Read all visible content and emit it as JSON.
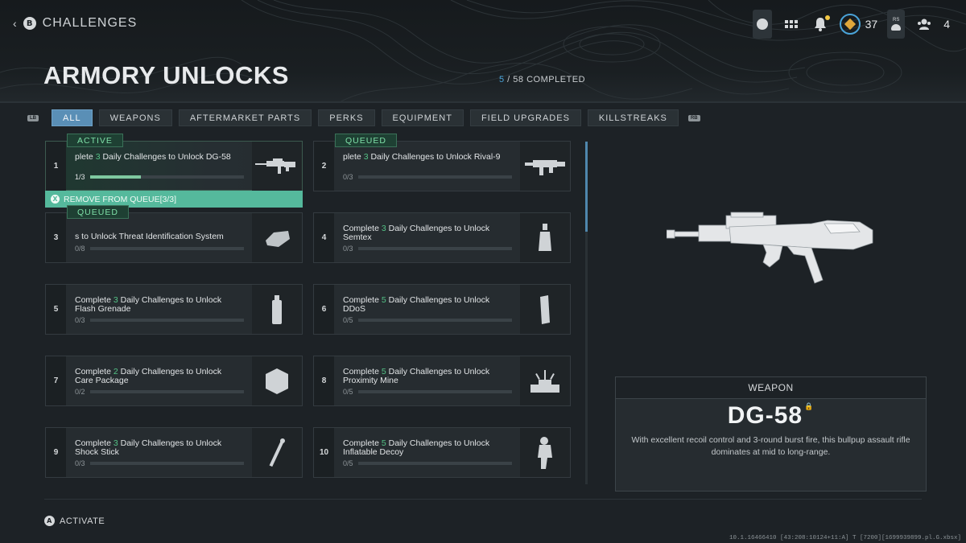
{
  "header": {
    "back_button_glyph": "B",
    "back_label": "CHALLENGES",
    "page_title": "ARMORY UNLOCKS",
    "completed_count": "5",
    "completed_rest": " / 58 COMPLETED"
  },
  "topbar": {
    "rank_level": "37",
    "rs_label": "RS",
    "friends_count": "4"
  },
  "tabs": {
    "left_bumper": "LB",
    "right_bumper": "RB",
    "items": [
      {
        "label": "ALL",
        "active": true
      },
      {
        "label": "WEAPONS"
      },
      {
        "label": "AFTERMARKET PARTS"
      },
      {
        "label": "PERKS"
      },
      {
        "label": "EQUIPMENT"
      },
      {
        "label": "FIELD UPGRADES"
      },
      {
        "label": "KILLSTREAKS"
      }
    ]
  },
  "challenges": [
    {
      "num": "1",
      "badge": "ACTIVE",
      "pre": "plete ",
      "n": "3",
      "post": " Daily Challenges to Unlock DG-58",
      "line2": "",
      "progress_text": "1/3",
      "progress": 0.33,
      "thumb": "rifle-thumb-icon"
    },
    {
      "num": "2",
      "badge": "QUEUED",
      "pre": "plete ",
      "n": "3",
      "post": " Daily Challenges to Unlock Rival-9",
      "line2": "",
      "progress_text": "0/3",
      "progress": 0,
      "thumb": "smg-thumb-icon"
    },
    {
      "num": "3",
      "badge": "QUEUED",
      "pre": "s to Unlock Threat Identification System",
      "n": "",
      "post": "",
      "line2": "",
      "progress_text": "0/8",
      "progress": 0,
      "thumb": "perk-thumb-icon"
    },
    {
      "num": "4",
      "badge": "",
      "pre": "Complete ",
      "n": "3",
      "post": " Daily Challenges to Unlock",
      "line2": "Semtex",
      "progress_text": "0/3",
      "progress": 0,
      "thumb": "semtex-thumb-icon"
    },
    {
      "num": "5",
      "badge": "",
      "pre": "Complete ",
      "n": "3",
      "post": " Daily Challenges to Unlock",
      "line2": "Flash Grenade",
      "progress_text": "0/3",
      "progress": 0,
      "thumb": "flash-grenade-thumb-icon"
    },
    {
      "num": "6",
      "badge": "",
      "pre": "Complete ",
      "n": "5",
      "post": " Daily Challenges to Unlock",
      "line2": "DDoS",
      "progress_text": "0/5",
      "progress": 0,
      "thumb": "ddos-thumb-icon"
    },
    {
      "num": "7",
      "badge": "",
      "pre": "Complete ",
      "n": "2",
      "post": " Daily Challenges to Unlock",
      "line2": "Care Package",
      "progress_text": "0/2",
      "progress": 0,
      "thumb": "care-package-thumb-icon"
    },
    {
      "num": "8",
      "badge": "",
      "pre": "Complete ",
      "n": "5",
      "post": " Daily Challenges to Unlock",
      "line2": "Proximity Mine",
      "progress_text": "0/5",
      "progress": 0,
      "thumb": "proximity-mine-thumb-icon"
    },
    {
      "num": "9",
      "badge": "",
      "pre": "Complete ",
      "n": "3",
      "post": " Daily Challenges to Unlock",
      "line2": "Shock Stick",
      "progress_text": "0/3",
      "progress": 0,
      "thumb": "shock-stick-thumb-icon"
    },
    {
      "num": "10",
      "badge": "",
      "pre": "Complete ",
      "n": "5",
      "post": " Daily Challenges to Unlock",
      "line2": "Inflatable Decoy",
      "progress_text": "0/5",
      "progress": 0,
      "thumb": "inflatable-decoy-thumb-icon"
    }
  ],
  "remove_queue": {
    "glyph": "X",
    "label": "REMOVE FROM QUEUE[3/3]"
  },
  "details": {
    "type": "WEAPON",
    "name": "DG-58",
    "description": "With excellent recoil control and 3-round burst fire, this bullpup assault rifle dominates at mid to long-range."
  },
  "footer": {
    "glyph": "A",
    "label": "ACTIVATE",
    "build_info": "10.1.16466410 [43:208:10124+11:A] T [7200][1699939899.pl.G.xbsx]"
  },
  "colors": {
    "accent_blue": "#4aa3d8",
    "active_green": "#7fe0a8",
    "queue_bar": "#55b99c",
    "count_green": "#54c286"
  }
}
